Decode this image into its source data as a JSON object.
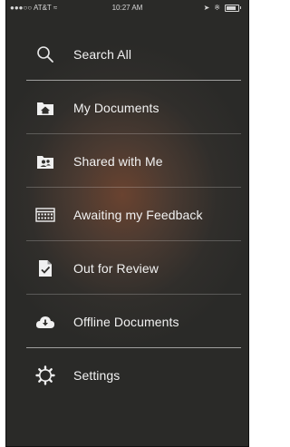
{
  "status_bar": {
    "carrier": "AT&T",
    "time": "10:27 AM"
  },
  "menu": {
    "items": [
      {
        "label": "Search All",
        "icon": "search-icon"
      },
      {
        "label": "My Documents",
        "icon": "home-folder-icon"
      },
      {
        "label": "Shared with Me",
        "icon": "shared-folder-icon"
      },
      {
        "label": "Awaiting my Feedback",
        "icon": "calendar-icon"
      },
      {
        "label": "Out for Review",
        "icon": "document-check-icon"
      },
      {
        "label": "Offline Documents",
        "icon": "cloud-download-icon"
      },
      {
        "label": "Settings",
        "icon": "gear-icon"
      }
    ]
  },
  "colors": {
    "background": "#2f2e2b",
    "glow": "#6a4330",
    "text": "#f2f2f2"
  }
}
